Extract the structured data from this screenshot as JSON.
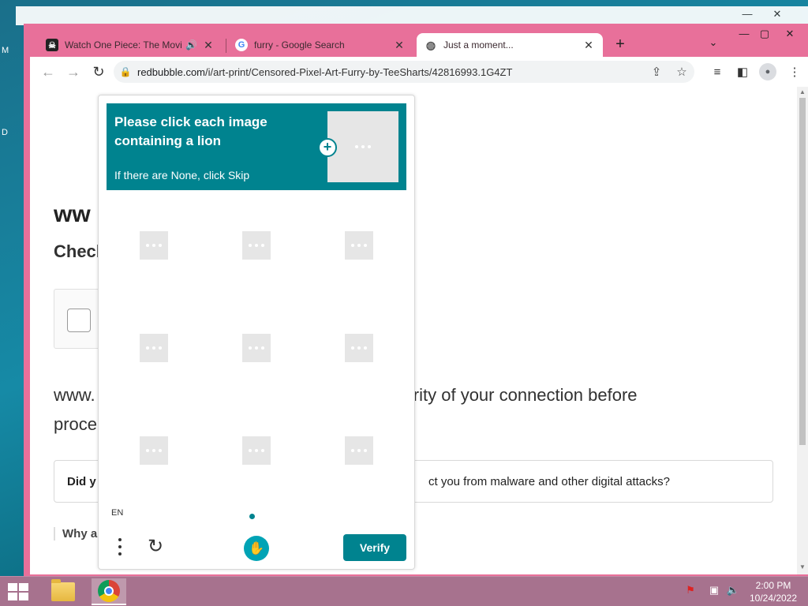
{
  "desktop": {
    "edge_labels": [
      "M",
      "D"
    ]
  },
  "browser": {
    "tabs": [
      {
        "title": "Watch One Piece: The Movie",
        "favicon": "onepiece-icon",
        "audio": true
      },
      {
        "title": "furry - Google Search",
        "favicon": "google-icon"
      },
      {
        "title": "Just a moment...",
        "favicon": "globe-icon",
        "active": true
      }
    ],
    "url_host": "redbubble.com",
    "url_path": "/i/art-print/Censored-Pixel-Art-Furry-by-TeeSharts/42816993.1G4ZT"
  },
  "page": {
    "title": "ww",
    "subtitle": "Check",
    "para_line1_left": "www.",
    "para_line1_right": "curity of your connection before",
    "para_line2": "proce",
    "details_left": "Did y",
    "details_right": "ct you from malware and other digital attacks?",
    "why": "Why a"
  },
  "captcha": {
    "prompt": "Please click each image containing a lion",
    "hint": "If there are None, click Skip",
    "language": "EN",
    "verify_label": "Verify",
    "tiles": 9,
    "accent": "#00838f"
  },
  "taskbar": {
    "time": "2:00 PM",
    "date": "10/24/2022"
  }
}
